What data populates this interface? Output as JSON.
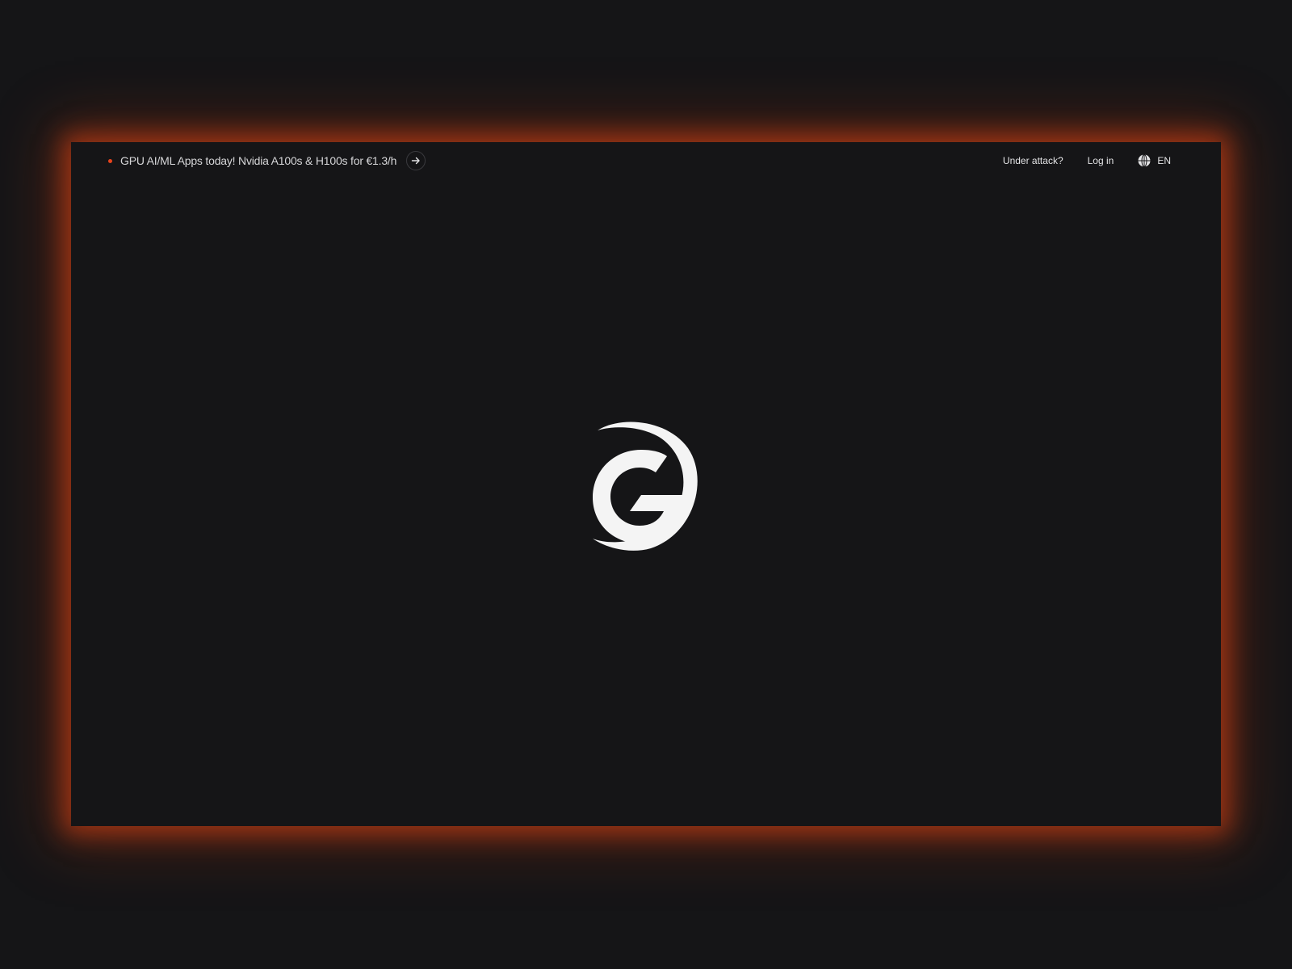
{
  "promo": {
    "text": "GPU AI/ML Apps today! Nvidia A100s & H100s for €1.3/h",
    "arrow_icon": "arrow-right-icon"
  },
  "nav": {
    "under_attack": "Under attack?",
    "login": "Log in",
    "language": "EN",
    "language_icon": "globe-icon"
  },
  "logo": {
    "icon": "g-logo-icon"
  },
  "colors": {
    "background": "#151517",
    "accent": "#e8431c",
    "text": "#e4e4e6"
  }
}
